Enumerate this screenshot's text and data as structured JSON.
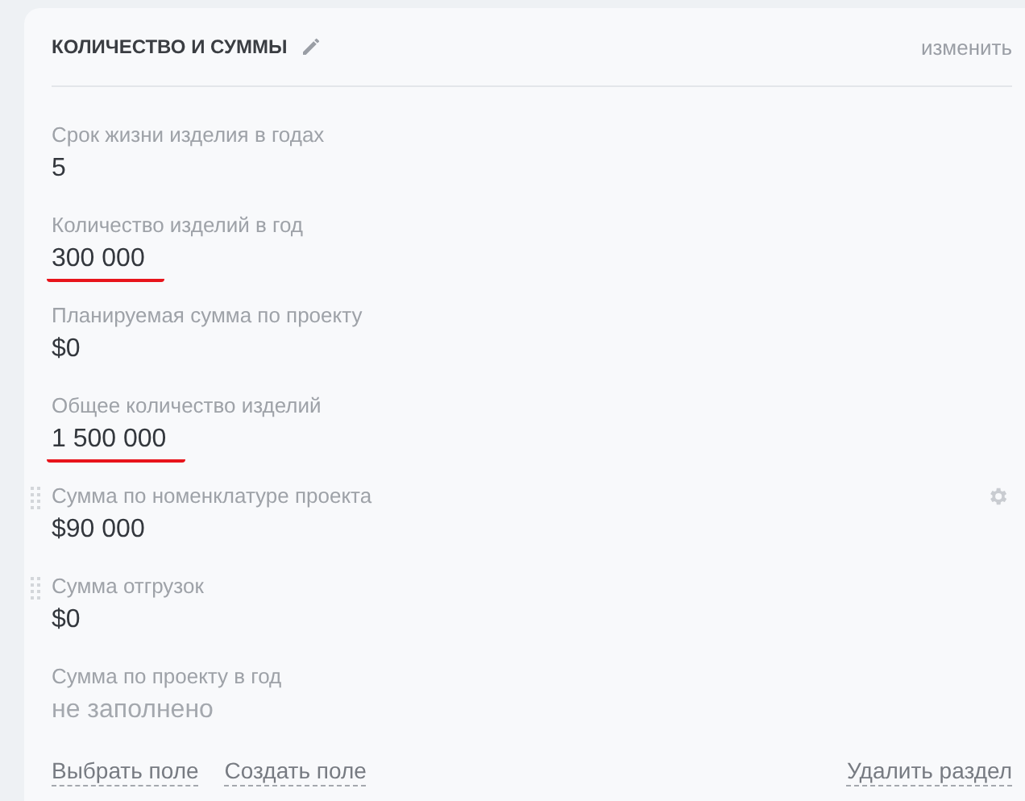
{
  "section": {
    "title": "КОЛИЧЕСТВО И СУММЫ",
    "edit_link": "изменить"
  },
  "fields": [
    {
      "label": "Срок жизни изделия в годах",
      "value": "5",
      "kind": "filled",
      "underlined": false,
      "drag_handle": false,
      "settings": false
    },
    {
      "label": "Количество изделий в год",
      "value": "300 000",
      "kind": "filled",
      "underlined": true,
      "drag_handle": false,
      "settings": false
    },
    {
      "label": "Планируемая сумма по проекту",
      "value": "$0",
      "kind": "filled",
      "underlined": false,
      "drag_handle": false,
      "settings": false
    },
    {
      "label": "Общее количество изделий",
      "value": "1 500 000",
      "kind": "filled",
      "underlined": true,
      "drag_handle": false,
      "settings": false
    },
    {
      "label": "Сумма по номенклатуре проекта",
      "value": "$90 000",
      "kind": "filled",
      "underlined": false,
      "drag_handle": true,
      "settings": true
    },
    {
      "label": "Сумма отгрузок",
      "value": "$0",
      "kind": "filled",
      "underlined": false,
      "drag_handle": true,
      "settings": false
    },
    {
      "label": "Сумма по проекту в год",
      "value": "не заполнено",
      "kind": "empty",
      "underlined": false,
      "drag_handle": false,
      "settings": false
    }
  ],
  "footer": {
    "left_links": [
      "Выбрать поле",
      "Создать поле"
    ],
    "right_link": "Удалить раздел"
  }
}
